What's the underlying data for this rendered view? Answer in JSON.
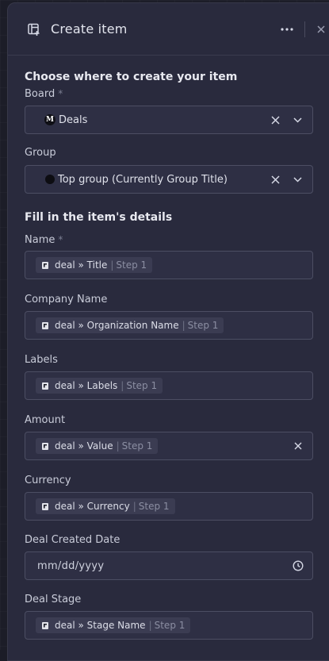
{
  "panel": {
    "title": "Create item"
  },
  "location": {
    "section_title": "Choose where to create your item",
    "board": {
      "label": "Board",
      "required": "*",
      "value": "Deals",
      "logo_letter": "M"
    },
    "group": {
      "label": "Group",
      "value": "Top group (Currently Group Title)"
    }
  },
  "details": {
    "section_title": "Fill in the item's details",
    "fields": [
      {
        "label": "Name",
        "required": "*",
        "path": "deal » Title",
        "sep": "|",
        "step": "Step 1"
      },
      {
        "label": "Company Name",
        "path": "deal » Organization Name",
        "sep": "|",
        "step": "Step 1"
      },
      {
        "label": "Labels",
        "path": "deal » Labels",
        "sep": "|",
        "step": "Step 1"
      },
      {
        "label": "Amount",
        "path": "deal » Value",
        "sep": "|",
        "step": "Step 1"
      },
      {
        "label": "Currency",
        "path": "deal » Currency",
        "sep": "|",
        "step": "Step 1"
      },
      {
        "label": "Deal Created Date",
        "placeholder": "mm/dd/yyyy"
      },
      {
        "label": "Deal Stage",
        "path": "deal » Stage Name",
        "sep": "|",
        "step": "Step 1"
      }
    ]
  }
}
